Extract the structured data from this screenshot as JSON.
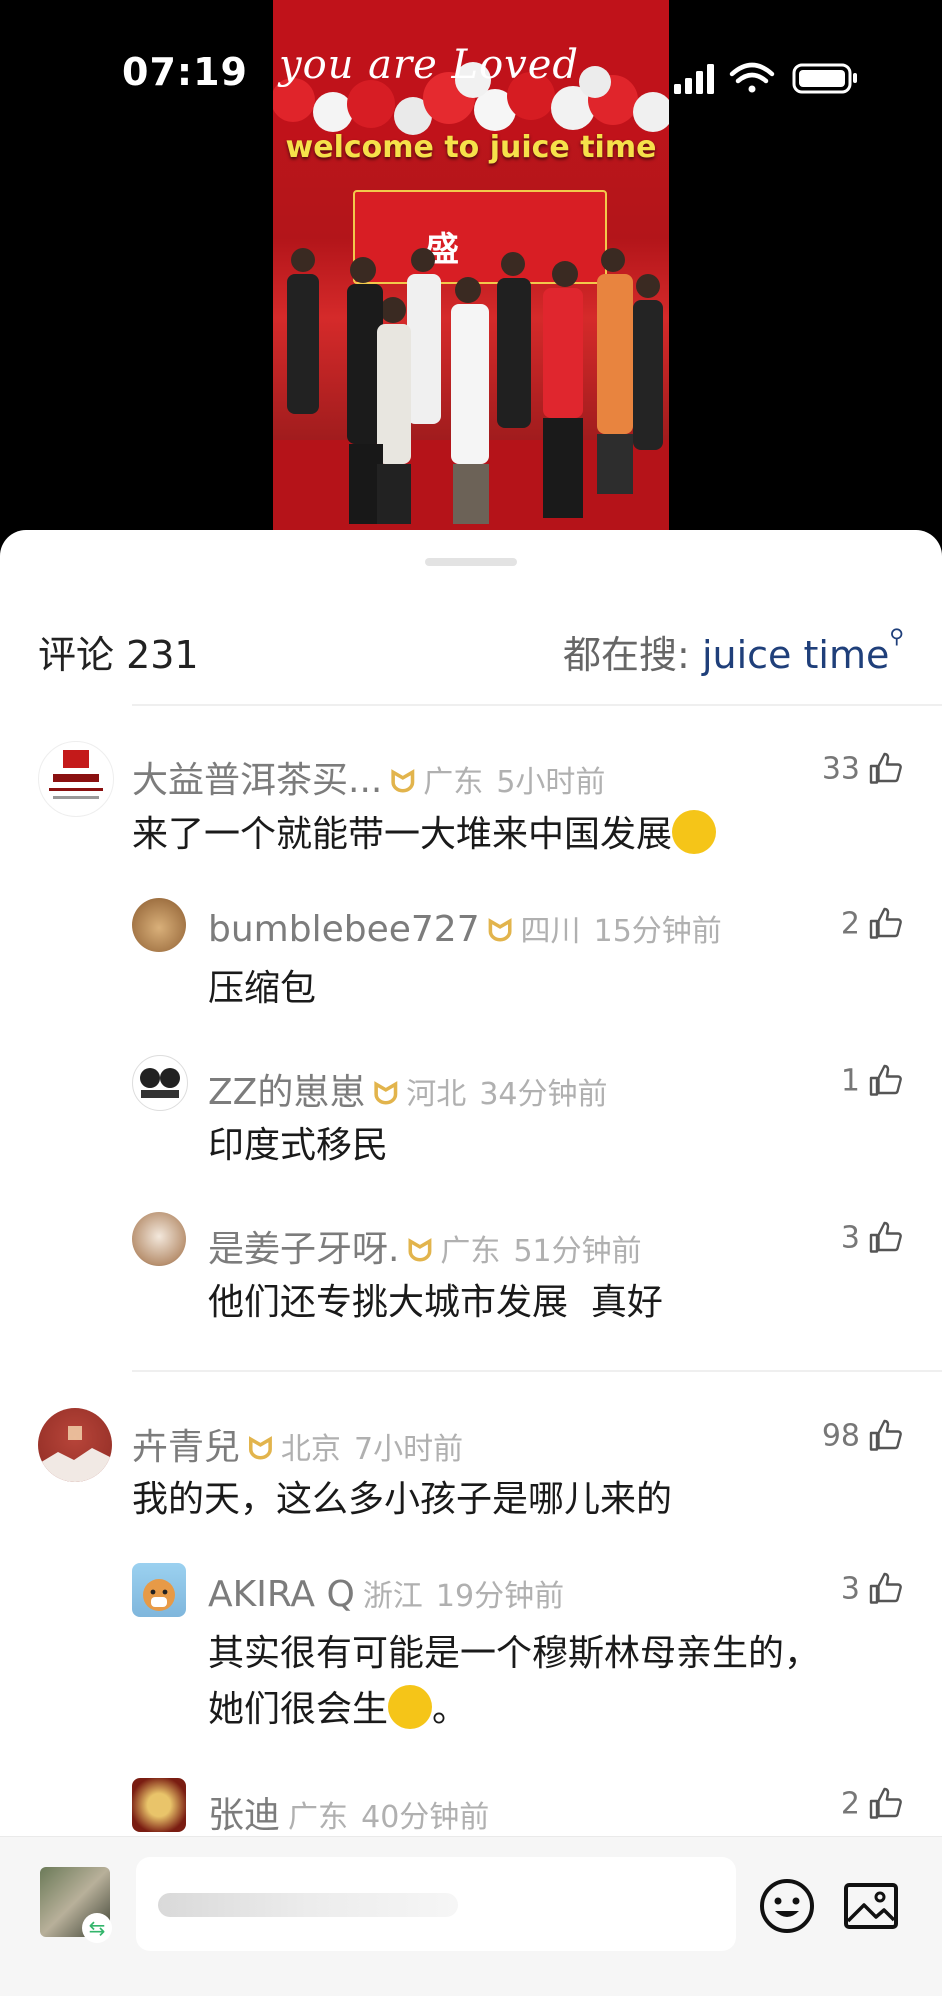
{
  "status_bar": {
    "time": "07:19"
  },
  "video": {
    "caption": "welcome to juice time",
    "script_text": "you are Loved",
    "sign_text": "盛"
  },
  "comments_panel": {
    "title": "评论 231",
    "search_prefix": "都在搜: ",
    "search_keyword": "juice time",
    "threads": [
      {
        "name": "大益普洱茶买...",
        "location": "广东",
        "time": "5小时前",
        "text": "来了一个就能带一大堆来中国发展",
        "likes": "33",
        "replies": [
          {
            "name": "bumblebee727",
            "location": "四川",
            "time": "15分钟前",
            "text": "压缩包",
            "likes": "2"
          },
          {
            "name": "ZZ的崽崽",
            "location": "河北",
            "time": "34分钟前",
            "text": "印度式移民",
            "likes": "1"
          },
          {
            "name": "是姜子牙呀.",
            "location": "广东",
            "time": "51分钟前",
            "text": "他们还专挑大城市发展  真好",
            "likes": "3"
          }
        ]
      },
      {
        "name": "卉青兒",
        "location": "北京",
        "time": "7小时前",
        "text": "我的天，这么多小孩子是哪儿来的",
        "likes": "98",
        "replies": [
          {
            "name": "AKIRA Q",
            "location": "浙江",
            "time": "19分钟前",
            "text_line1": "其实很有可能是一个穆斯林母亲生的，",
            "text_line2": "她们很会生",
            "text_line2_end": "。",
            "likes": "3"
          },
          {
            "name": "张迪",
            "location": "广东",
            "time": "40分钟前",
            "likes": "2"
          }
        ]
      }
    ]
  },
  "icons": {
    "badge": "fan-badge-icon",
    "like": "thumb-up-icon",
    "emoji_button": "emoji-icon",
    "image_button": "image-icon",
    "search": "magnifier-icon"
  },
  "colors": {
    "accent": "#1f3f7a",
    "badge": "#e2b44c",
    "caption": "#f6e14a"
  }
}
